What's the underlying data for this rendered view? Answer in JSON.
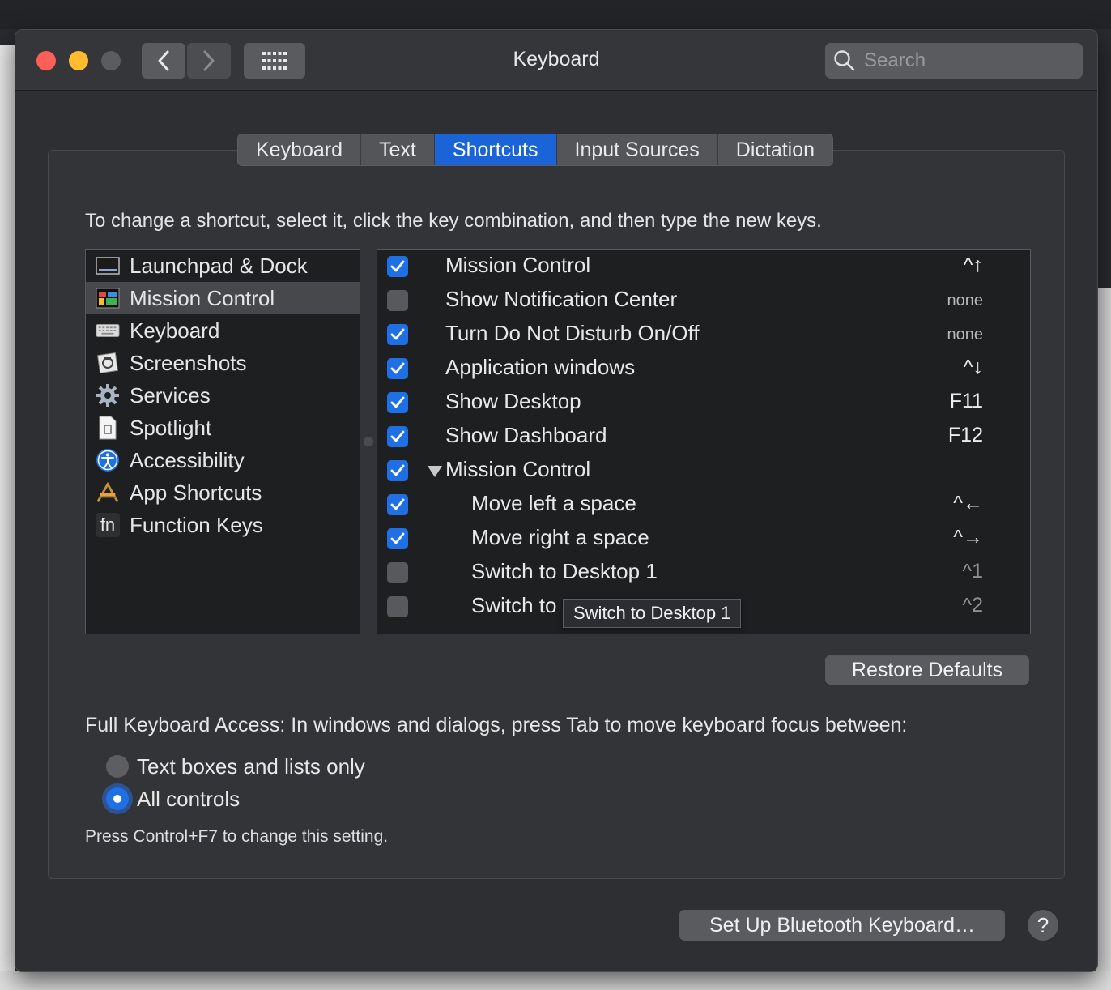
{
  "window": {
    "title": "Keyboard"
  },
  "search": {
    "placeholder": "Search"
  },
  "tabs": [
    {
      "label": "Keyboard"
    },
    {
      "label": "Text"
    },
    {
      "label": "Shortcuts"
    },
    {
      "label": "Input Sources"
    },
    {
      "label": "Dictation"
    }
  ],
  "active_tab": "Shortcuts",
  "instruction": "To change a shortcut, select it, click the key combination, and then type the new keys.",
  "categories": [
    {
      "label": "Launchpad & Dock",
      "icon": "launchpad-dock-icon"
    },
    {
      "label": "Mission Control",
      "icon": "mission-control-icon",
      "selected": true
    },
    {
      "label": "Keyboard",
      "icon": "keyboard-icon"
    },
    {
      "label": "Screenshots",
      "icon": "screenshots-icon"
    },
    {
      "label": "Services",
      "icon": "gear-icon"
    },
    {
      "label": "Spotlight",
      "icon": "document-icon"
    },
    {
      "label": "Accessibility",
      "icon": "accessibility-icon"
    },
    {
      "label": "App Shortcuts",
      "icon": "app-shortcuts-icon"
    },
    {
      "label": "Function Keys",
      "icon": "fn-icon",
      "glyph": "fn"
    }
  ],
  "shortcuts": [
    {
      "label": "Mission Control",
      "checked": true,
      "key": "^↑"
    },
    {
      "label": "Show Notification Center",
      "checked": false,
      "key": "none"
    },
    {
      "label": "Turn Do Not Disturb On/Off",
      "checked": true,
      "key": "none"
    },
    {
      "label": "Application windows",
      "checked": true,
      "key": "^↓"
    },
    {
      "label": "Show Desktop",
      "checked": true,
      "key": "F11"
    },
    {
      "label": "Show Dashboard",
      "checked": true,
      "key": "F12"
    },
    {
      "label": "Mission Control",
      "checked": true,
      "key": "",
      "group": true
    },
    {
      "label": "Move left a space",
      "checked": true,
      "key": "^←",
      "indent": true
    },
    {
      "label": "Move right a space",
      "checked": true,
      "key": "^→",
      "indent": true
    },
    {
      "label": "Switch to Desktop 1",
      "checked": false,
      "key": "^1",
      "indent": true,
      "dim": true
    },
    {
      "label": "Switch to",
      "checked": false,
      "key": "^2",
      "indent": true,
      "dim": true
    }
  ],
  "tooltip": "Switch to Desktop 1",
  "restore_defaults": "Restore Defaults",
  "full_keyboard_access": {
    "label": "Full Keyboard Access: In windows and dialogs, press Tab to move keyboard focus between:",
    "options": [
      {
        "label": "Text boxes and lists only",
        "selected": false
      },
      {
        "label": "All controls",
        "selected": true
      }
    ],
    "hint": "Press Control+F7 to change this setting."
  },
  "bluetooth_button": "Set Up Bluetooth Keyboard…",
  "help_button": "?",
  "colors": {
    "accent": "#1f6fe5",
    "tab_active": "#1a64d8"
  }
}
